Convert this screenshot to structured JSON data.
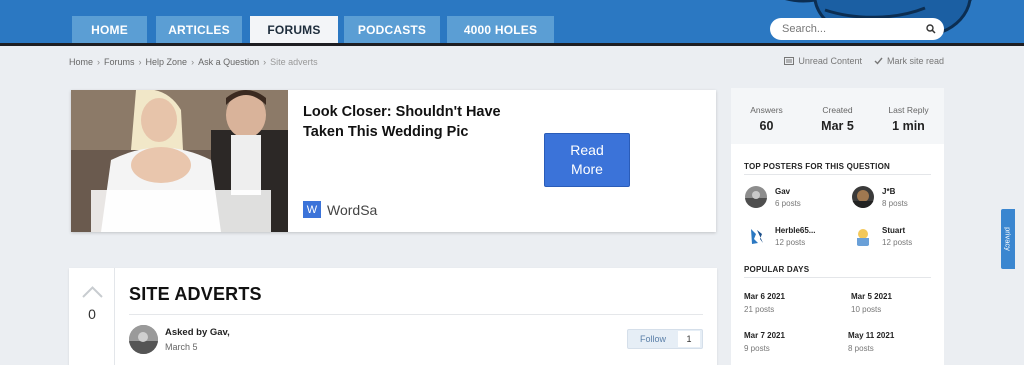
{
  "nav": {
    "tabs": [
      {
        "label": "HOME",
        "active": false
      },
      {
        "label": "ARTICLES",
        "active": false
      },
      {
        "label": "FORUMS",
        "active": true
      },
      {
        "label": "PODCASTS",
        "active": false
      },
      {
        "label": "4000 HOLES",
        "active": false
      }
    ],
    "search_placeholder": "Search..."
  },
  "breadcrumb": [
    "Home",
    "Forums",
    "Help Zone",
    "Ask a Question",
    "Site adverts"
  ],
  "top_links": {
    "unread": "Unread Content",
    "mark_read": "Mark site read"
  },
  "ad": {
    "title": "Look Closer: Shouldn't Have Taken This Wedding Pic",
    "button": "Read\nMore",
    "brand_letter": "W",
    "brand": "WordSa"
  },
  "post": {
    "votes": "0",
    "title": "SITE ADVERTS",
    "asked_by": "Asked by Gav,",
    "date": "March 5",
    "follow_label": "Follow",
    "follow_count": "1"
  },
  "sidebar": {
    "stats": [
      {
        "label": "Answers",
        "value": "60"
      },
      {
        "label": "Created",
        "value": "Mar 5"
      },
      {
        "label": "Last Reply",
        "value": "1 min"
      }
    ],
    "top_posters_title": "TOP POSTERS FOR THIS QUESTION",
    "posters": [
      {
        "name": "Gav",
        "posts": "6 posts"
      },
      {
        "name": "J*B",
        "posts": "8 posts"
      },
      {
        "name": "Herble65...",
        "posts": "12 posts"
      },
      {
        "name": "Stuart",
        "posts": "12 posts"
      }
    ],
    "popular_days_title": "POPULAR DAYS",
    "days": [
      {
        "date": "Mar 6 2021",
        "posts": "21 posts"
      },
      {
        "date": "Mar 5 2021",
        "posts": "10 posts"
      },
      {
        "date": "Mar 7 2021",
        "posts": "9 posts"
      },
      {
        "date": "May 11 2021",
        "posts": "8 posts"
      }
    ]
  },
  "privacy_label": "privacy",
  "colors": {
    "nav_blue": "#2b78c2",
    "tab_blue": "#5b9ed4",
    "button_blue": "#3b73d9",
    "page_bg": "#ebeef2"
  }
}
